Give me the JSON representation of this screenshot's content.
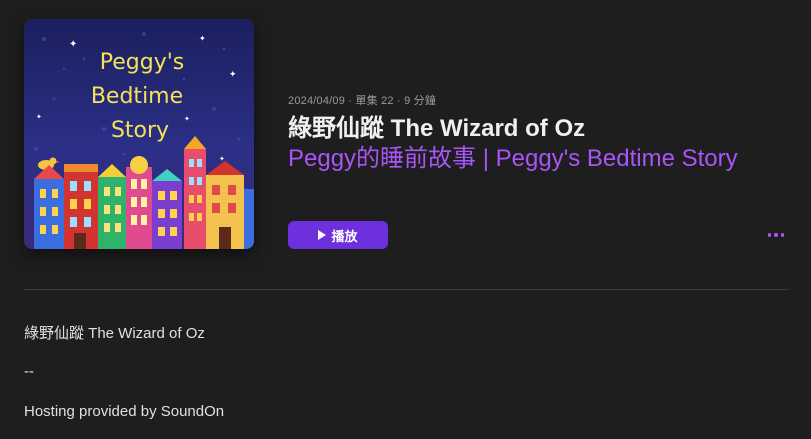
{
  "artwork": {
    "title_lines": [
      "Peggy's",
      "Bedtime",
      "Story"
    ],
    "icon": "show-artwork"
  },
  "episode": {
    "meta": "2024/04/09 · 單集 22 · 9 分鐘",
    "title": "綠野仙蹤 The Wizard of Oz",
    "show_name": "Peggy的睡前故事 | Peggy's Bedtime Story"
  },
  "actions": {
    "play_label": "播放",
    "more_icon": "ellipsis-icon"
  },
  "description": {
    "lines": [
      "綠野仙蹤 The Wizard of Oz",
      "--",
      "Hosting provided by SoundOn"
    ]
  },
  "colors": {
    "background": "#1e1e1e",
    "accent": "#a855f7",
    "play_button": "#6e2fdc",
    "divider": "#3a3a3a"
  }
}
